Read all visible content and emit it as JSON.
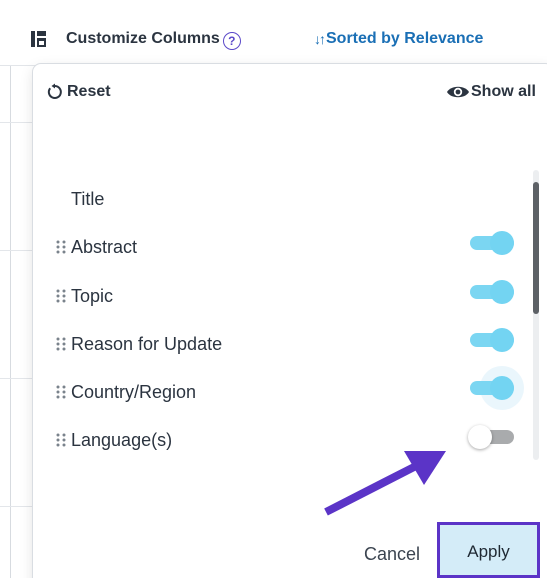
{
  "header": {
    "customize_label": "Customize Columns",
    "help_glyph": "?",
    "sort_label": "Sorted by Relevance",
    "sort_glyph": "↓↑"
  },
  "panel": {
    "reset_label": "Reset",
    "show_all_label": "Show all",
    "columns": [
      {
        "label": "Title",
        "fixed": true
      },
      {
        "label": "Abstract",
        "enabled": true
      },
      {
        "label": "Topic",
        "enabled": true
      },
      {
        "label": "Reason for Update",
        "enabled": true
      },
      {
        "label": "Country/Region",
        "enabled": true
      },
      {
        "label": "Language(s)",
        "enabled": false
      }
    ],
    "cancel_label": "Cancel",
    "apply_label": "Apply"
  },
  "colors": {
    "toggle_on": "#73d4f2",
    "toggle_off": "#a9abad",
    "highlight": "#5b34c7",
    "sort_link": "#1a6fb5",
    "apply_bg": "#d4ecf8"
  }
}
